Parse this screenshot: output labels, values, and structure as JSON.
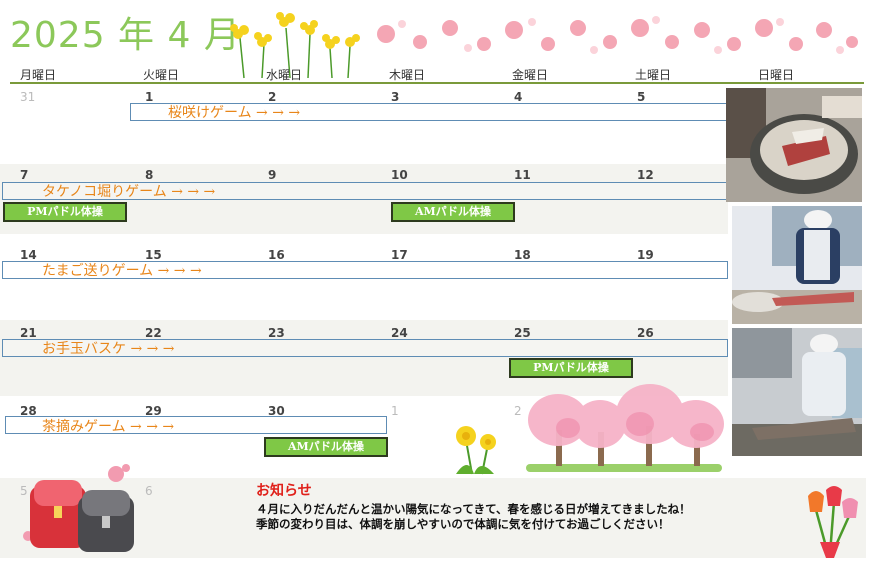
{
  "header": {
    "title": "2025 年 4 月",
    "weekdays": [
      "月曜日",
      "火曜日",
      "水曜日",
      "木曜日",
      "金曜日",
      "土曜日",
      "日曜日"
    ]
  },
  "weeks": [
    {
      "days": [
        "31",
        "1",
        "2",
        "3",
        "4",
        "5"
      ]
    },
    {
      "days": [
        "7",
        "8",
        "9",
        "10",
        "11",
        "12"
      ]
    },
    {
      "days": [
        "14",
        "15",
        "16",
        "17",
        "18",
        "19"
      ]
    },
    {
      "days": [
        "21",
        "22",
        "23",
        "24",
        "25",
        "26"
      ]
    },
    {
      "days": [
        "28",
        "29",
        "30",
        "1",
        "2"
      ]
    },
    {
      "days": [
        "5",
        "6"
      ]
    }
  ],
  "events": [
    "桜咲けゲーム →  →  →",
    "タケノコ堀りゲーム →  →  →",
    "たまご送りゲーム →  →  →",
    "お手玉バスケ →  →  →",
    "茶摘みゲーム →  →  →"
  ],
  "activities": {
    "pm1": "PMパドル体操",
    "am1": "AMパドル体操",
    "pm2": "PMパドル体操",
    "am2": "AMパドル体操"
  },
  "notice": {
    "title": "お知らせ",
    "line1": "４月に入りだんだんと温かい陽気になってきて、春を感じる日が増えてきましたね！",
    "line2": "季節の変わり目は、体調を崩しやすいので体調に気を付けてお過ごしください！"
  },
  "colors": {
    "title": "#8cc85a",
    "event_text": "#e8861a",
    "event_border": "#5e8cb4",
    "pill": "#7fc846",
    "notice_title": "#e0201a"
  },
  "icons": [
    "rapeseed-flower-icon",
    "cherry-petal-icon",
    "dandelion-icon",
    "cherry-tree-icon",
    "school-backpack-icon",
    "tulip-bouquet-icon"
  ]
}
